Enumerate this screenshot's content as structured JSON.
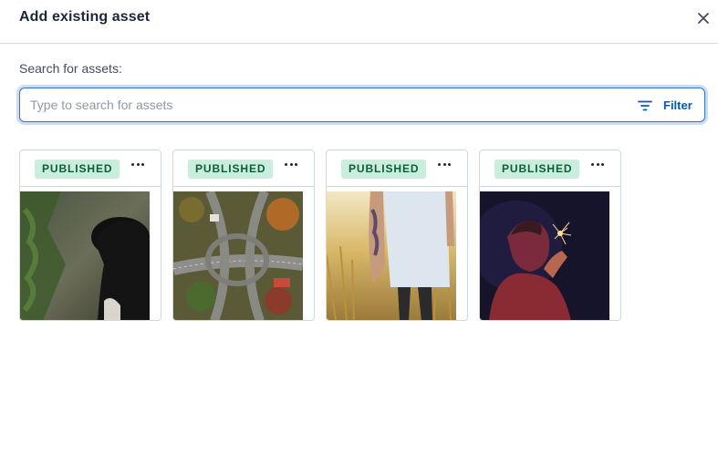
{
  "modal": {
    "title": "Add existing asset",
    "close_icon": "close-icon"
  },
  "search": {
    "label": "Search for assets:",
    "placeholder": "Type to search for assets",
    "value": "",
    "filter_label": "Filter",
    "filter_icon": "filter-icon"
  },
  "colors": {
    "accent": "#2e75d4",
    "link": "#0059c8",
    "badge_bg": "#c9eedd",
    "badge_text": "#0e5d36"
  },
  "assets": [
    {
      "status": "PUBLISHED",
      "menu_icon": "more-icon",
      "image": "woman-in-hat-forest-photo"
    },
    {
      "status": "PUBLISHED",
      "menu_icon": "more-icon",
      "image": "aerial-highway-interchange-photo"
    },
    {
      "status": "PUBLISHED",
      "menu_icon": "more-icon",
      "image": "tattooed-person-in-field-photo"
    },
    {
      "status": "PUBLISHED",
      "menu_icon": "more-icon",
      "image": "man-with-sparkler-photo"
    }
  ]
}
